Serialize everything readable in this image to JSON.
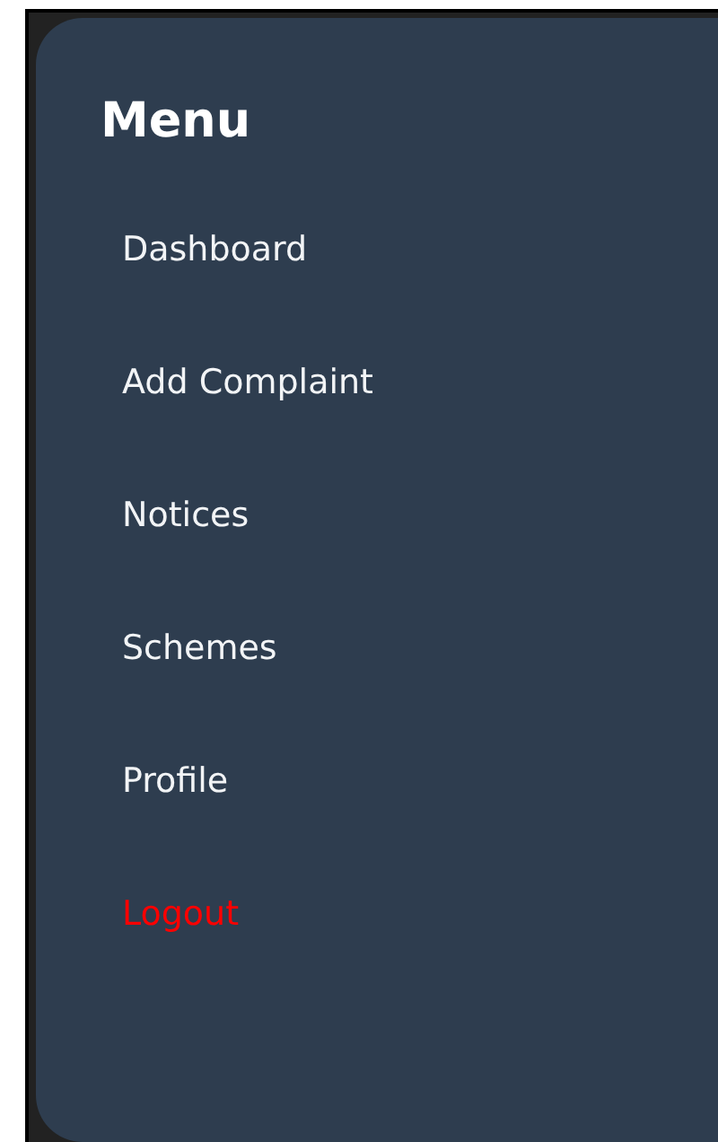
{
  "sidebar": {
    "title": "Menu",
    "items": [
      {
        "label": "Dashboard",
        "kind": "link"
      },
      {
        "label": "Add Complaint",
        "kind": "link"
      },
      {
        "label": "Notices",
        "kind": "link"
      },
      {
        "label": "Schemes",
        "kind": "link"
      },
      {
        "label": "Profile",
        "kind": "link"
      },
      {
        "label": "Logout",
        "kind": "danger"
      }
    ]
  }
}
